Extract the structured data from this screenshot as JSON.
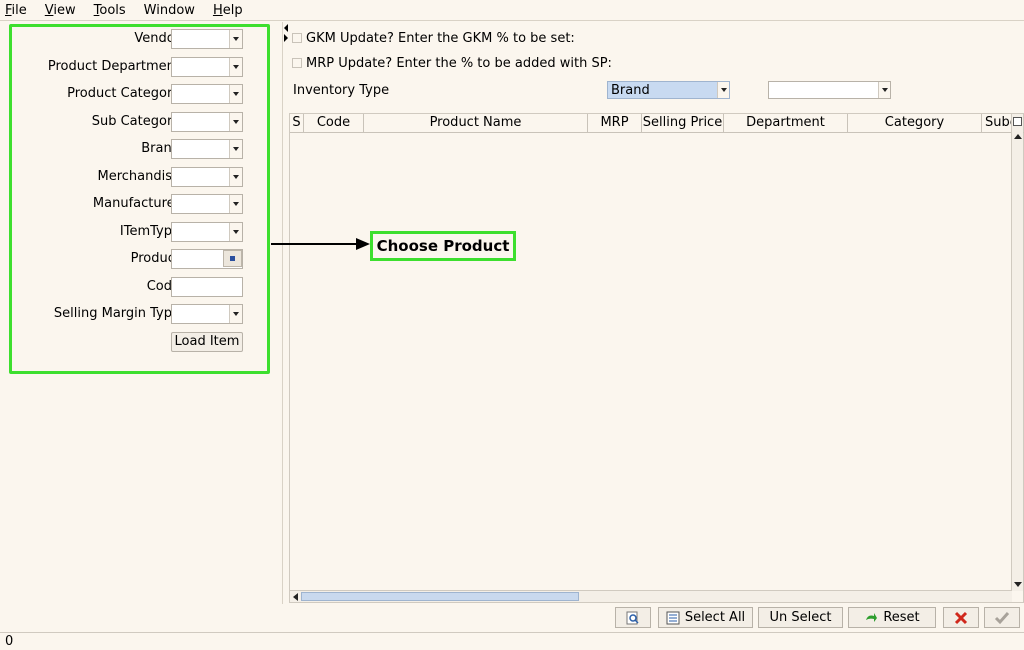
{
  "menu": [
    {
      "pre": "",
      "u": "F",
      "post": "ile"
    },
    {
      "pre": "",
      "u": "V",
      "post": "iew"
    },
    {
      "pre": "",
      "u": "T",
      "post": "ools"
    },
    {
      "pre": "Window",
      "u": "",
      "post": ""
    },
    {
      "pre": "",
      "u": "H",
      "post": "elp"
    }
  ],
  "filters": {
    "vendor": "Vendor",
    "product_department": "Product Department",
    "product_category": "Product Category",
    "sub_category": "Sub Category",
    "brand": "Brand",
    "merchandise": "Merchandise",
    "manufacturer": "Manufacturer",
    "item_type": "ITemType",
    "product": "Product",
    "code": "Code",
    "selling_margin_type": "Selling Margin Type",
    "load_item": "Load Item"
  },
  "options": {
    "gkm_update": "GKM Update? Enter the GKM % to be set:",
    "mrp_update": "MRP Update? Enter the % to be added with SP:",
    "inventory_type_label": "Inventory Type",
    "inventory_type_value": "Brand"
  },
  "grid": {
    "columns": [
      "S",
      "Code",
      "Product Name",
      "MRP",
      "Selling Price",
      "Department",
      "Category",
      "Subc"
    ]
  },
  "callout": "Choose Product",
  "toolbar": {
    "select_all": "Select All",
    "un_select": "Un Select",
    "reset": "Reset"
  },
  "status": "0",
  "colors": {
    "highlight": "#3ddf2e",
    "selection": "#c8daf1"
  }
}
